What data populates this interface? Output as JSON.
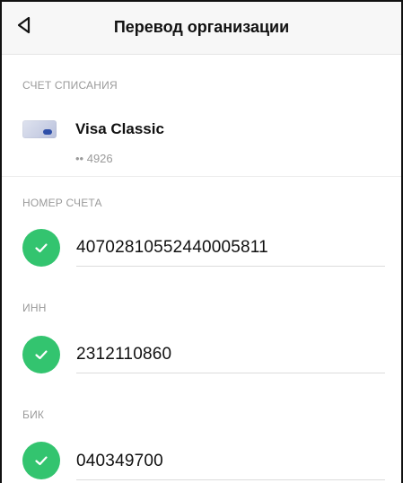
{
  "header": {
    "title": "Перевод организации",
    "back_icon": "back-triangle-icon"
  },
  "debit_account": {
    "section_label": "СЧЕТ СПИСАНИЯ",
    "card_icon": "card-icon",
    "card_name": "Visa Classic",
    "card_number": "•• 4926"
  },
  "fields": [
    {
      "label": "НОМЕР СЧЕТА",
      "value": "40702810552440005811",
      "status_icon": "check-icon",
      "status_color": "#33c46f"
    },
    {
      "label": "ИНН",
      "value": "2312110860",
      "status_icon": "check-icon",
      "status_color": "#33c46f"
    },
    {
      "label": "БИК",
      "value": "040349700",
      "status_icon": "check-icon",
      "status_color": "#33c46f"
    }
  ]
}
